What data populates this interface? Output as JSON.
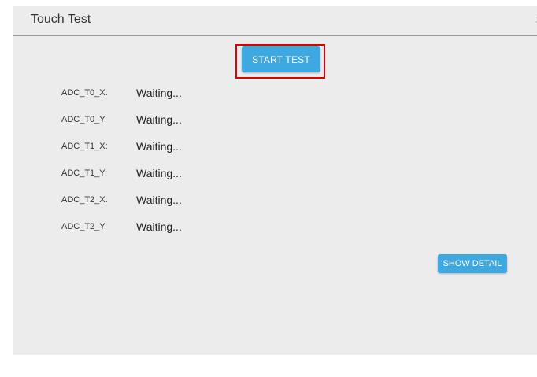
{
  "dialog": {
    "title": "Touch Test",
    "close_glyph": "›"
  },
  "start_button": {
    "label": "START TEST"
  },
  "readings": [
    {
      "label": "ADC_T0_X:",
      "value": "Waiting..."
    },
    {
      "label": "ADC_T0_Y:",
      "value": "Waiting..."
    },
    {
      "label": "ADC_T1_X:",
      "value": "Waiting..."
    },
    {
      "label": "ADC_T1_Y:",
      "value": "Waiting..."
    },
    {
      "label": "ADC_T2_X:",
      "value": "Waiting..."
    },
    {
      "label": "ADC_T2_Y:",
      "value": "Waiting..."
    }
  ],
  "detail_button": {
    "label": "SHOW DETAIL"
  },
  "colors": {
    "accent": "#3ea8e0",
    "highlight": "#e00000",
    "background": "#ececec"
  }
}
